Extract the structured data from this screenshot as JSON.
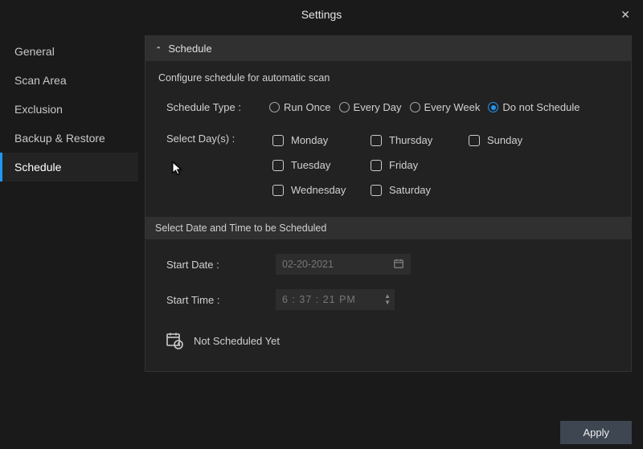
{
  "window": {
    "title": "Settings"
  },
  "sidebar": {
    "items": [
      {
        "label": "General"
      },
      {
        "label": "Scan Area"
      },
      {
        "label": "Exclusion"
      },
      {
        "label": "Backup & Restore"
      },
      {
        "label": "Schedule"
      }
    ]
  },
  "schedule": {
    "header": "Schedule",
    "subtitle": "Configure schedule for automatic scan",
    "type_label": "Schedule Type :",
    "type_options": {
      "run_once": "Run Once",
      "every_day": "Every Day",
      "every_week": "Every Week",
      "do_not": "Do not Schedule"
    },
    "days_label": "Select Day(s) :",
    "days": {
      "mon": "Monday",
      "tue": "Tuesday",
      "wed": "Wednesday",
      "thu": "Thursday",
      "fri": "Friday",
      "sat": "Saturday",
      "sun": "Sunday"
    },
    "datetime_header": "Select Date and Time to be Scheduled",
    "start_date_label": "Start Date :",
    "start_date_value": "02-20-2021",
    "start_time_label": "Start Time :",
    "start_time_value": "6 : 37 : 21  PM",
    "status": "Not Scheduled Yet"
  },
  "buttons": {
    "apply": "Apply"
  }
}
